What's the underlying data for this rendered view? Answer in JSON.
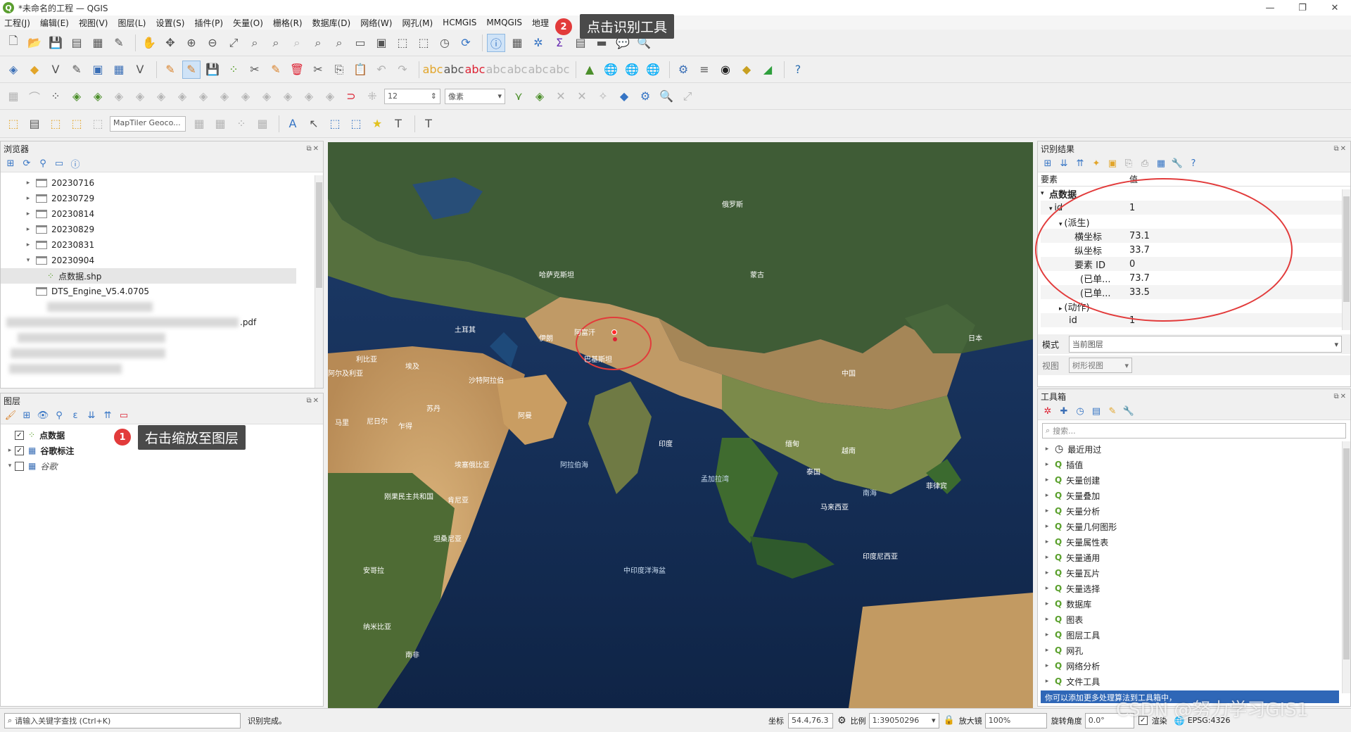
{
  "window": {
    "title": "*未命名的工程 — QGIS",
    "app_letter": "Q"
  },
  "menu": [
    "工程(J)",
    "编辑(E)",
    "视图(V)",
    "图层(L)",
    "设置(S)",
    "插件(P)",
    "矢量(O)",
    "栅格(R)",
    "数据库(D)",
    "网络(W)",
    "网孔(M)",
    "HCMGIS",
    "MMQGIS",
    "地理"
  ],
  "toolbar": {
    "map_tiler_label": "MapTiler Geoco...",
    "snap_tolerance": "12",
    "snap_unit": "像素"
  },
  "browser": {
    "title": "浏览器",
    "items": [
      {
        "label": "20230716",
        "expanded": false
      },
      {
        "label": "20230729",
        "expanded": false
      },
      {
        "label": "20230814",
        "expanded": false
      },
      {
        "label": "20230829",
        "expanded": false
      },
      {
        "label": "20230831",
        "expanded": false
      },
      {
        "label": "20230904",
        "expanded": true
      }
    ],
    "child_file": "点数据.shp",
    "extra_item": "DTS_Engine_V5.4.0705",
    "pdf_suffix": ".pdf"
  },
  "layers": {
    "title": "图层",
    "items": [
      {
        "label": "点数据",
        "checked": true,
        "bold": true
      },
      {
        "label": "谷歌标注",
        "checked": true,
        "bold": true
      },
      {
        "label": "谷歌",
        "checked": false,
        "italic": true
      }
    ]
  },
  "annotations": [
    {
      "number": "1",
      "text": "右击缩放至图层"
    },
    {
      "number": "2",
      "text": "点击识别工具"
    }
  ],
  "identify": {
    "title": "识别结果",
    "col_feature": "要素",
    "col_value": "值",
    "layer": "点数据",
    "rows": [
      {
        "key": "id",
        "value": "1"
      },
      {
        "key": "(派生)",
        "value": ""
      },
      {
        "key": "横坐标",
        "value": "73.1"
      },
      {
        "key": "纵坐标",
        "value": "33.7"
      },
      {
        "key": "要素 ID",
        "value": "0"
      },
      {
        "key": "(已单...",
        "value": "73.7"
      },
      {
        "key": "(已单...",
        "value": "33.5"
      },
      {
        "key": "(动作)",
        "value": ""
      },
      {
        "key": "id",
        "value": "1"
      }
    ],
    "mode_label": "模式",
    "mode_value": "当前图层",
    "view_label": "视图",
    "view_value": "树形视图"
  },
  "toolbox": {
    "title": "工具箱",
    "search_placeholder": "搜索...",
    "items": [
      "最近用过",
      "插值",
      "矢量创建",
      "矢量叠加",
      "矢量分析",
      "矢量几何图形",
      "矢量属性表",
      "矢量通用",
      "矢量瓦片",
      "矢量选择",
      "数据库",
      "图表",
      "图层工具",
      "网孔",
      "网络分析",
      "文件工具"
    ],
    "hint": "你可以添加更多处理算法到工具箱中，"
  },
  "map_labels": [
    "中国",
    "印度",
    "蒙古",
    "俄罗斯",
    "哈萨克斯坦",
    "伊朗",
    "沙特阿拉伯",
    "埃及",
    "利比亚",
    "阿尔及利亚",
    "马里",
    "尼日尔",
    "乍得",
    "苏丹",
    "埃塞俄比亚",
    "肯尼亚",
    "坦桑尼亚",
    "刚果民主共和国",
    "安哥拉",
    "南非",
    "纳米比亚",
    "缅甸",
    "泰国",
    "越南",
    "印度尼西亚",
    "菲律宾",
    "日本",
    "土耳其",
    "阿曼",
    "阿富汗",
    "巴基斯坦",
    "阿拉伯海",
    "孟加拉湾",
    "中印度洋海盆",
    "南海",
    "马来西亚"
  ],
  "statusbar": {
    "search_placeholder": "请输入关键字查找 (Ctrl+K)",
    "message": "识别完成。",
    "coord_label": "坐标",
    "coord_value": "54.4,76.3",
    "scale_label": "比例",
    "scale_value": "1:39050296",
    "magnifier_label": "放大镜",
    "magnifier_value": "100%",
    "rotation_label": "旋转角度",
    "rotation_value": "0.0°",
    "render_label": "渲染",
    "crs_value": "EPSG:4326",
    "watermark": "CSDN @努力学习GIS1"
  }
}
